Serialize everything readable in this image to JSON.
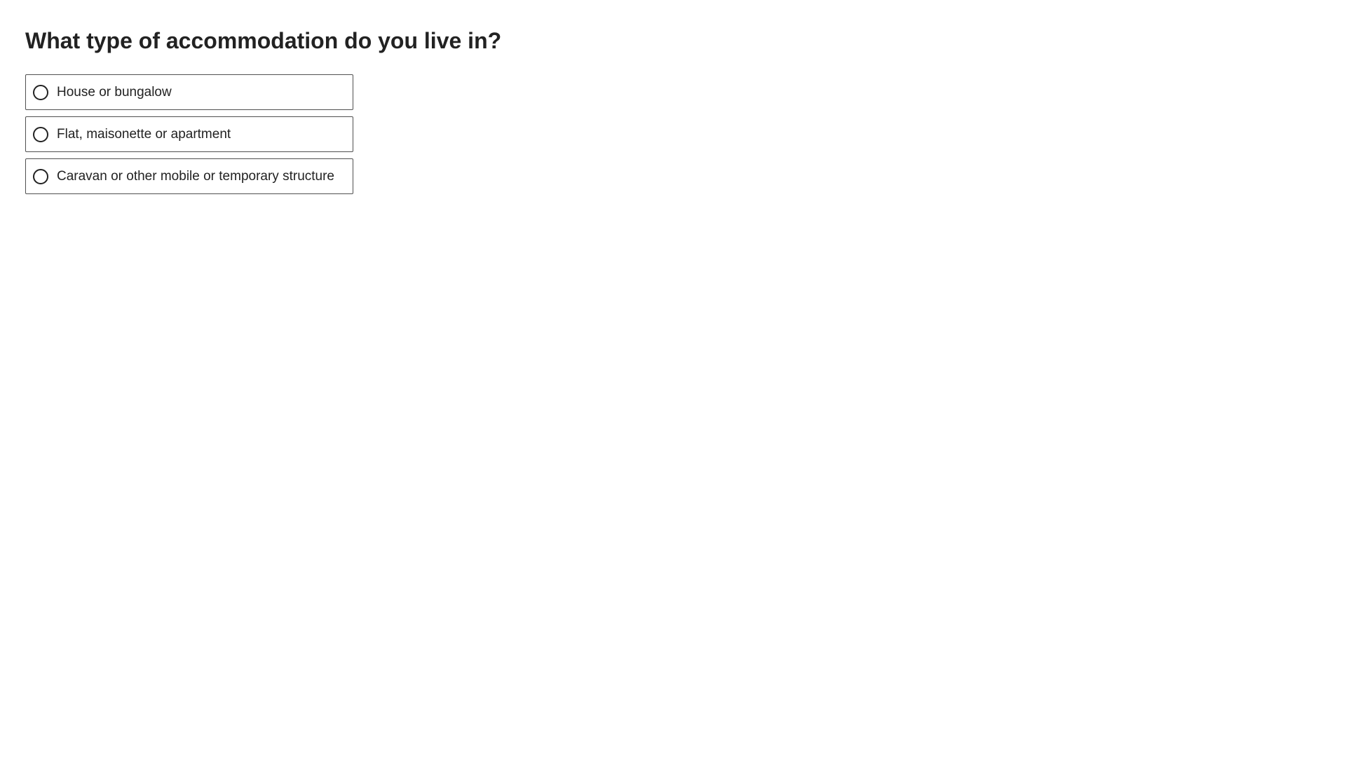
{
  "question": {
    "title": "What type of accommodation do you live in?"
  },
  "options": [
    {
      "label": "House or bungalow",
      "selected": false
    },
    {
      "label": "Flat, maisonette or apartment",
      "selected": false
    },
    {
      "label": "Caravan or other mobile or temporary structure",
      "selected": false
    }
  ],
  "colors": {
    "text": "#222222",
    "border": "#505050",
    "background": "#ffffff"
  }
}
